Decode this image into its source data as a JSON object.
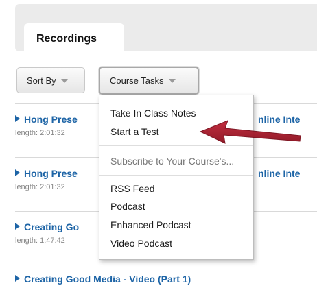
{
  "tabs": {
    "active_label": "Recordings"
  },
  "toolbar": {
    "sort_label": "Sort By",
    "tasks_label": "Course Tasks"
  },
  "recordings": [
    {
      "title": "Hong Prese",
      "title_tail": "nline Inte",
      "length": "length: 2:01:32"
    },
    {
      "title": "Hong Prese",
      "title_tail": "nline Inte",
      "length": "length: 2:01:32"
    },
    {
      "title": "Creating Go",
      "length": "length: 1:47:42"
    },
    {
      "title": "Creating Good Media - Video (Part 1)"
    }
  ],
  "menu": {
    "items": [
      {
        "label": "Take In Class Notes"
      },
      {
        "label": "Start a Test"
      },
      {
        "label": "Subscribe to Your Course's..."
      },
      {
        "label": "RSS Feed"
      },
      {
        "label": "Podcast"
      },
      {
        "label": "Enhanced Podcast"
      },
      {
        "label": "Video Podcast"
      }
    ]
  },
  "colors": {
    "link": "#1d64a6",
    "arrow": "#a0182a"
  },
  "icons": {
    "caret": "caret-down-icon",
    "expand": "triangle-right-icon",
    "annotation": "red-arrow-icon"
  }
}
